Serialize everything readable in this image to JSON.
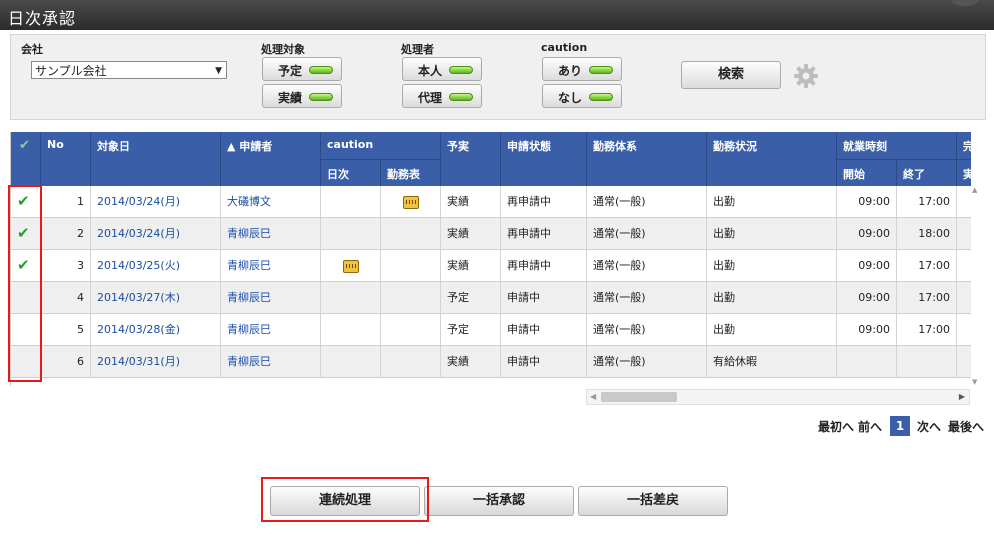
{
  "header": {
    "title": "日次承認"
  },
  "filters": {
    "company_label": "会社",
    "company_value": "サンプル会社",
    "target_label": "処理対象",
    "target_plan": "予定",
    "target_actual": "実績",
    "processor_label": "処理者",
    "processor_self": "本人",
    "processor_proxy": "代理",
    "caution_label": "caution",
    "caution_yes": "あり",
    "caution_no": "なし",
    "search_label": "検索"
  },
  "grid": {
    "headers": {
      "no": "No",
      "date": "対象日",
      "applicant": "▲ 申請者",
      "caution": "caution",
      "caution_daily": "日次",
      "caution_sheet": "勤務表",
      "plan_actual": "予実",
      "status": "申請状態",
      "work_system": "勤務体系",
      "work_status": "勤務状況",
      "work_time": "就業時刻",
      "start": "開始",
      "end": "終了",
      "next": "実",
      "next_top": "完"
    },
    "rows": [
      {
        "checked": true,
        "no": "1",
        "date": "2014/03/24(月)",
        "applicant": "大礒博文",
        "caution_daily": false,
        "caution_sheet": true,
        "plan_actual": "実績",
        "status": "再申請中",
        "work_system": "通常(一般)",
        "work_status": "出勤",
        "start": "09:00",
        "end": "17:00"
      },
      {
        "checked": true,
        "no": "2",
        "date": "2014/03/24(月)",
        "applicant": "青柳辰巳",
        "caution_daily": false,
        "caution_sheet": false,
        "plan_actual": "実績",
        "status": "再申請中",
        "work_system": "通常(一般)",
        "work_status": "出勤",
        "start": "09:00",
        "end": "18:00"
      },
      {
        "checked": true,
        "no": "3",
        "date": "2014/03/25(火)",
        "applicant": "青柳辰巳",
        "caution_daily": true,
        "caution_sheet": false,
        "plan_actual": "実績",
        "status": "再申請中",
        "work_system": "通常(一般)",
        "work_status": "出勤",
        "start": "09:00",
        "end": "17:00"
      },
      {
        "checked": false,
        "no": "4",
        "date": "2014/03/27(木)",
        "applicant": "青柳辰巳",
        "caution_daily": false,
        "caution_sheet": false,
        "plan_actual": "予定",
        "status": "申請中",
        "work_system": "通常(一般)",
        "work_status": "出勤",
        "start": "09:00",
        "end": "17:00"
      },
      {
        "checked": false,
        "no": "5",
        "date": "2014/03/28(金)",
        "applicant": "青柳辰巳",
        "caution_daily": false,
        "caution_sheet": false,
        "plan_actual": "予定",
        "status": "申請中",
        "work_system": "通常(一般)",
        "work_status": "出勤",
        "start": "09:00",
        "end": "17:00"
      },
      {
        "checked": false,
        "no": "6",
        "date": "2014/03/31(月)",
        "applicant": "青柳辰巳",
        "caution_daily": false,
        "caution_sheet": false,
        "plan_actual": "実績",
        "status": "申請中",
        "work_system": "通常(一般)",
        "work_status": "有給休暇",
        "start": "",
        "end": ""
      }
    ]
  },
  "pager": {
    "first": "最初へ",
    "prev": "前へ",
    "current": "1",
    "next": "次へ",
    "last": "最後へ"
  },
  "actions": {
    "continuous": "連続処理",
    "bulk_approve": "一括承認",
    "bulk_return": "一括差戻"
  },
  "colors": {
    "header_blue": "#3a5fa8",
    "led_green": "#57b812",
    "highlight_red": "#e21b1b",
    "check_green": "#2b9a2b"
  }
}
